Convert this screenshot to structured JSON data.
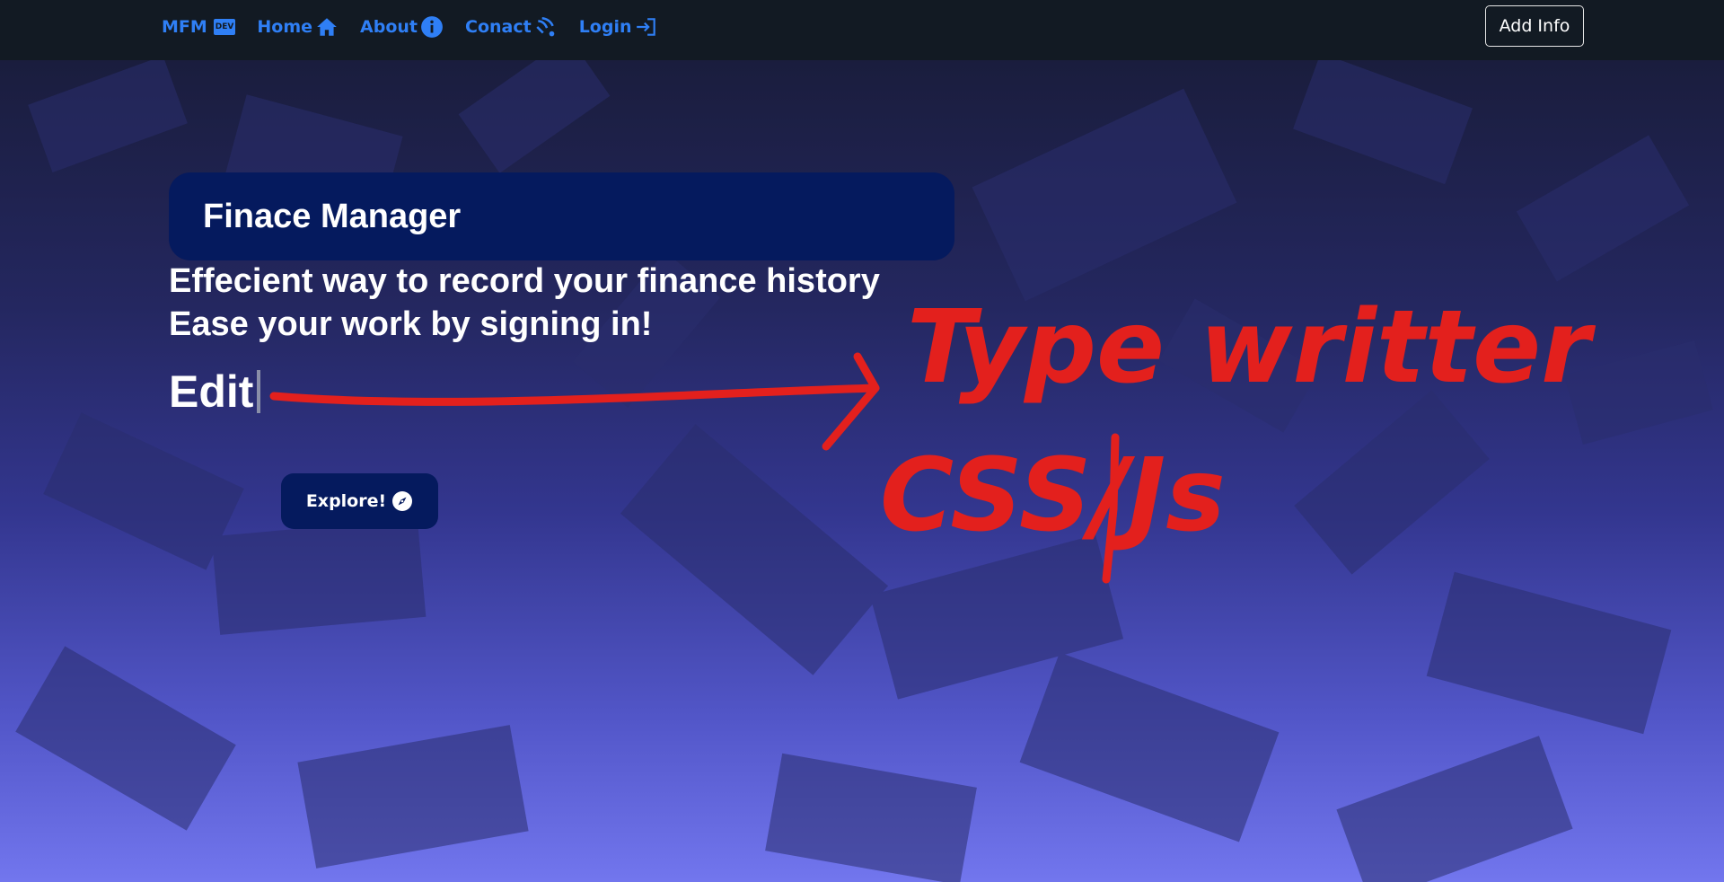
{
  "navbar": {
    "brand": "MFM",
    "brand_badge": "DEV",
    "links": [
      {
        "label": "Home",
        "icon": "home-icon"
      },
      {
        "label": "About",
        "icon": "info-icon"
      },
      {
        "label": "Conact",
        "icon": "contact-icon"
      },
      {
        "label": "Login",
        "icon": "login-icon"
      }
    ],
    "add_info_label": "Add Info"
  },
  "hero": {
    "title": "Finace Manager",
    "tagline_1": "Effecient way to record your finance history",
    "tagline_2": "Ease your work by signing in!",
    "typewriter_text": "Edit",
    "explore_label": "Explore!"
  },
  "annotation": {
    "line_1": "Type writter",
    "line_2": "CSS/Js",
    "color": "#e3201d"
  },
  "colors": {
    "nav_bg": "#121a23",
    "link": "#2f7ff5",
    "card_bg": "#051a5e"
  }
}
